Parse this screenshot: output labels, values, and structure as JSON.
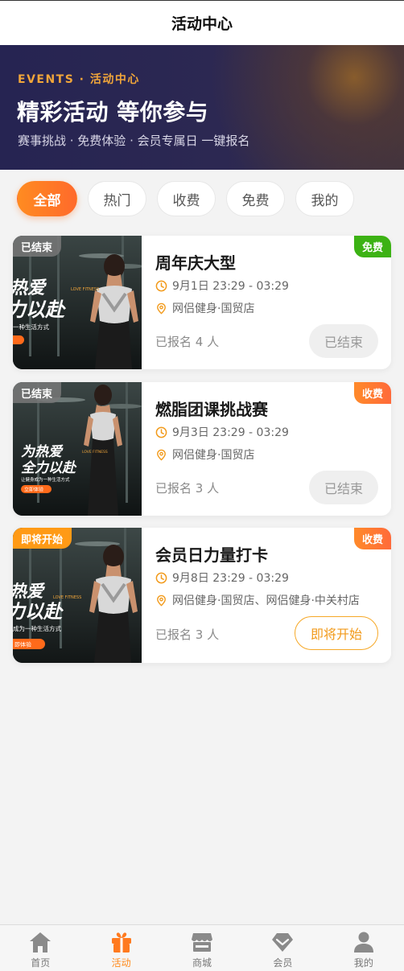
{
  "navbar": {
    "title": "活动中心"
  },
  "hero": {
    "eyebrow": "EVENTS · 活动中心",
    "title": "精彩活动 等你参与",
    "subtitle": "赛事挑战 · 免费体验 · 会员专属日 一键报名"
  },
  "filters": [
    {
      "label": "全部",
      "active": true
    },
    {
      "label": "热门",
      "active": false
    },
    {
      "label": "收费",
      "active": false
    },
    {
      "label": "免费",
      "active": false
    },
    {
      "label": "我的",
      "active": false
    }
  ],
  "events": [
    {
      "status": "已结束",
      "fee": "免费",
      "title": "周年庆大型",
      "time": "9月1日 23:29 - 03:29",
      "location": "网侣健身·国贸店",
      "enrolled": "已报名 4 人",
      "action": "已结束",
      "poster": {
        "big_line1": "热爱",
        "big_line2": "力以赴",
        "small": "一种生活方式",
        "brand": "LOVE FITNESS"
      }
    },
    {
      "status": "已结束",
      "fee": "收费",
      "title": "燃脂团课挑战赛",
      "time": "9月3日 23:29 - 03:29",
      "location": "网侣健身·国贸店",
      "enrolled": "已报名 3 人",
      "action": "已结束",
      "poster": {
        "big_line1": "为热爱",
        "big_line2": "全力以赴",
        "small": "让健身成为一种生活方式",
        "brand": "LOVE FITNESS",
        "button": "立即体验"
      }
    },
    {
      "status": "即将开始",
      "fee": "收费",
      "title": "会员日力量打卡",
      "time": "9月8日 23:29 - 03:29",
      "location": "网侣健身·国贸店、网侣健身·中关村店",
      "enrolled": "已报名 3 人",
      "action": "即将开始",
      "poster": {
        "big_line1": "热爱",
        "big_line2": "力以赴",
        "small": "成为一种生活方式",
        "brand": "LOVE FITNESS",
        "button": "即体验"
      }
    }
  ],
  "tabbar": [
    {
      "label": "首页",
      "icon": "home-icon",
      "active": false
    },
    {
      "label": "活动",
      "icon": "gift-icon",
      "active": true
    },
    {
      "label": "商城",
      "icon": "store-icon",
      "active": false
    },
    {
      "label": "会员",
      "icon": "diamond-icon",
      "active": false
    },
    {
      "label": "我的",
      "icon": "user-icon",
      "active": false
    }
  ],
  "colors": {
    "accent": "#ff8a1c",
    "hero_bg": "#262452",
    "free": "#3cb214",
    "paid": "#ff7a30",
    "upcoming": "#ff9a16"
  }
}
